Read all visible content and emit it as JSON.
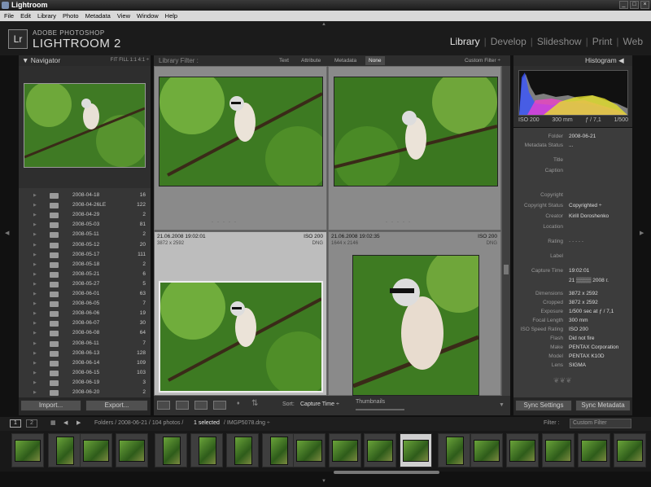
{
  "window": {
    "title": "Lightroom",
    "controls": [
      "_",
      "□",
      "×"
    ]
  },
  "menu": [
    "File",
    "Edit",
    "Library",
    "Photo",
    "Metadata",
    "View",
    "Window",
    "Help"
  ],
  "brand": {
    "logo": "Lr",
    "line1": "ADOBE PHOTOSHOP",
    "line2": "LIGHTROOM 2"
  },
  "modules": [
    {
      "label": "Library",
      "active": true
    },
    {
      "label": "Develop"
    },
    {
      "label": "Slideshow"
    },
    {
      "label": "Print"
    },
    {
      "label": "Web"
    }
  ],
  "navigator": {
    "title": "Navigator",
    "options": "FIT  FILL  1:1  4:1 ÷"
  },
  "folders": [
    {
      "name": "2008-04-18",
      "count": "16"
    },
    {
      "name": "2008-04-26LE",
      "count": "122"
    },
    {
      "name": "2008-04-29",
      "count": "2"
    },
    {
      "name": "2008-05-03",
      "count": "81"
    },
    {
      "name": "2008-05-11",
      "count": "2"
    },
    {
      "name": "2008-05-12",
      "count": "20"
    },
    {
      "name": "2008-05-17",
      "count": "111"
    },
    {
      "name": "2008-05-18",
      "count": "2"
    },
    {
      "name": "2008-05-21",
      "count": "6"
    },
    {
      "name": "2008-05-27",
      "count": "5"
    },
    {
      "name": "2008-06-01",
      "count": "63"
    },
    {
      "name": "2008-06-05",
      "count": "7"
    },
    {
      "name": "2008-06-06",
      "count": "19"
    },
    {
      "name": "2008-06-07",
      "count": "30"
    },
    {
      "name": "2008-06-08",
      "count": "64"
    },
    {
      "name": "2008-06-11",
      "count": "7"
    },
    {
      "name": "2008-06-13",
      "count": "128"
    },
    {
      "name": "2008-06-14",
      "count": "109"
    },
    {
      "name": "2008-06-15",
      "count": "103"
    },
    {
      "name": "2008-06-19",
      "count": "3"
    },
    {
      "name": "2008-06-20",
      "count": "2"
    }
  ],
  "left_buttons": {
    "import": "Import...",
    "export": "Export..."
  },
  "filter": {
    "label": "Library Filter :",
    "options": [
      "Text",
      "Attribute",
      "Metadata",
      "None"
    ],
    "selected": "None",
    "custom": "Custom Filter ÷"
  },
  "grid": {
    "cell3": {
      "date": "21.06.2008 19:02:01",
      "iso": "ISO 200",
      "dims": "3872 x 2592",
      "fmt": "DNG"
    },
    "cell4": {
      "date": "21.06.2008 19:02:35",
      "iso": "ISO 200",
      "dims": "1644 x 2146",
      "fmt": "DNG"
    }
  },
  "toolbar": {
    "sort_label": "Sort:",
    "sort_value": "Capture Time ÷",
    "thumbs": "Thumbnails"
  },
  "histogram": {
    "title": "Histogram",
    "iso": "ISO 200",
    "focal": "300 mm",
    "aperture": "ƒ / 7,1",
    "shutter": "1/500"
  },
  "metadata": [
    {
      "k": "Folder",
      "v": "2008-06-21"
    },
    {
      "k": "Metadata Status",
      "v": "..."
    },
    {
      "k": "Title",
      "v": ""
    },
    {
      "k": "Caption",
      "v": ""
    },
    {
      "k": "Copyright",
      "v": ""
    },
    {
      "k": "Copyright Status",
      "v": "Copyrighted ÷"
    },
    {
      "k": "Creator",
      "v": "Kirill Doroshenko"
    },
    {
      "k": "Location",
      "v": ""
    },
    {
      "k": "Rating",
      "v": "·  ·  ·  ·  ·"
    },
    {
      "k": "Label",
      "v": ""
    },
    {
      "k": "Capture Time",
      "v": "19:02:01"
    },
    {
      "k": "",
      "v": "21 ▒▒▒▒ 2008 г."
    },
    {
      "k": "Dimensions",
      "v": "3872 x 2592"
    },
    {
      "k": "Cropped",
      "v": "3872 x 2592"
    },
    {
      "k": "Exposure",
      "v": "1/500 sec at ƒ / 7,1"
    },
    {
      "k": "Focal Length",
      "v": "300 mm"
    },
    {
      "k": "ISO Speed Rating",
      "v": "ISO 200"
    },
    {
      "k": "Flash",
      "v": "Did not fire"
    },
    {
      "k": "Make",
      "v": "PENTAX Corporation"
    },
    {
      "k": "Model",
      "v": "PENTAX K10D"
    },
    {
      "k": "Lens",
      "v": "SIGMA"
    }
  ],
  "sync": {
    "settings": "Sync Settings",
    "metadata": "Sync Metadata"
  },
  "filmhead": {
    "page1": "1",
    "page2": "2",
    "path": "Folders / 2008-06-21 / 104 photos /",
    "selected": "1 selected",
    "file": "/ IMGP5078.dng ÷",
    "filter_label": "Filter :",
    "filter_value": "Custom Filter"
  }
}
